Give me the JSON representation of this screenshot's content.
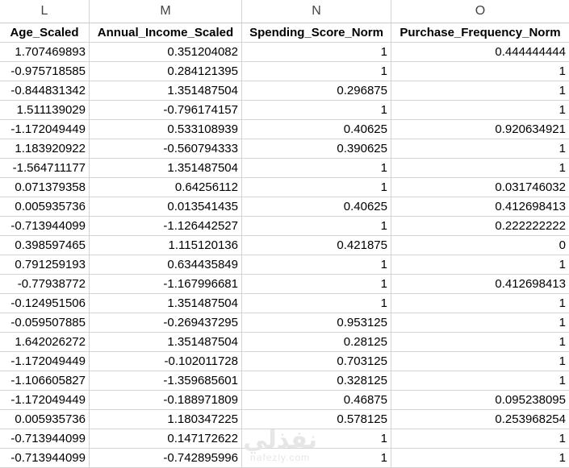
{
  "column_letters": [
    "L",
    "M",
    "N",
    "O"
  ],
  "headers": [
    "Age_Scaled",
    "Annual_Income_Scaled",
    "Spending_Score_Norm",
    "Purchase_Frequency_Norm"
  ],
  "rows": [
    [
      "1.707469893",
      "0.351204082",
      "1",
      "0.444444444"
    ],
    [
      "-0.975718585",
      "0.284121395",
      "1",
      "1"
    ],
    [
      "-0.844831342",
      "1.351487504",
      "0.296875",
      "1"
    ],
    [
      "1.511139029",
      "-0.796174157",
      "1",
      "1"
    ],
    [
      "-1.172049449",
      "0.533108939",
      "0.40625",
      "0.920634921"
    ],
    [
      "1.183920922",
      "-0.560794333",
      "0.390625",
      "1"
    ],
    [
      "-1.564711177",
      "1.351487504",
      "1",
      "1"
    ],
    [
      "0.071379358",
      "0.64256112",
      "1",
      "0.031746032"
    ],
    [
      "0.005935736",
      "0.013541435",
      "0.40625",
      "0.412698413"
    ],
    [
      "-0.713944099",
      "-1.126442527",
      "1",
      "0.222222222"
    ],
    [
      "0.398597465",
      "1.115120136",
      "0.421875",
      "0"
    ],
    [
      "0.791259193",
      "0.634435849",
      "1",
      "1"
    ],
    [
      "-0.77938772",
      "-1.167996681",
      "1",
      "0.412698413"
    ],
    [
      "-0.124951506",
      "1.351487504",
      "1",
      "1"
    ],
    [
      "-0.059507885",
      "-0.269437295",
      "0.953125",
      "1"
    ],
    [
      "1.642026272",
      "1.351487504",
      "0.28125",
      "1"
    ],
    [
      "-1.172049449",
      "-0.102011728",
      "0.703125",
      "1"
    ],
    [
      "-1.106605827",
      "-1.359685601",
      "0.328125",
      "1"
    ],
    [
      "-1.172049449",
      "-0.188971809",
      "0.46875",
      "0.095238095"
    ],
    [
      "0.005935736",
      "1.180347225",
      "0.578125",
      "0.253968254"
    ],
    [
      "-0.713944099",
      "0.147172622",
      "1",
      "1"
    ],
    [
      "-0.713944099",
      "-0.742895996",
      "1",
      "1"
    ]
  ],
  "watermark": {
    "arabic": "نفذلي",
    "latin": "nafezly.com"
  }
}
